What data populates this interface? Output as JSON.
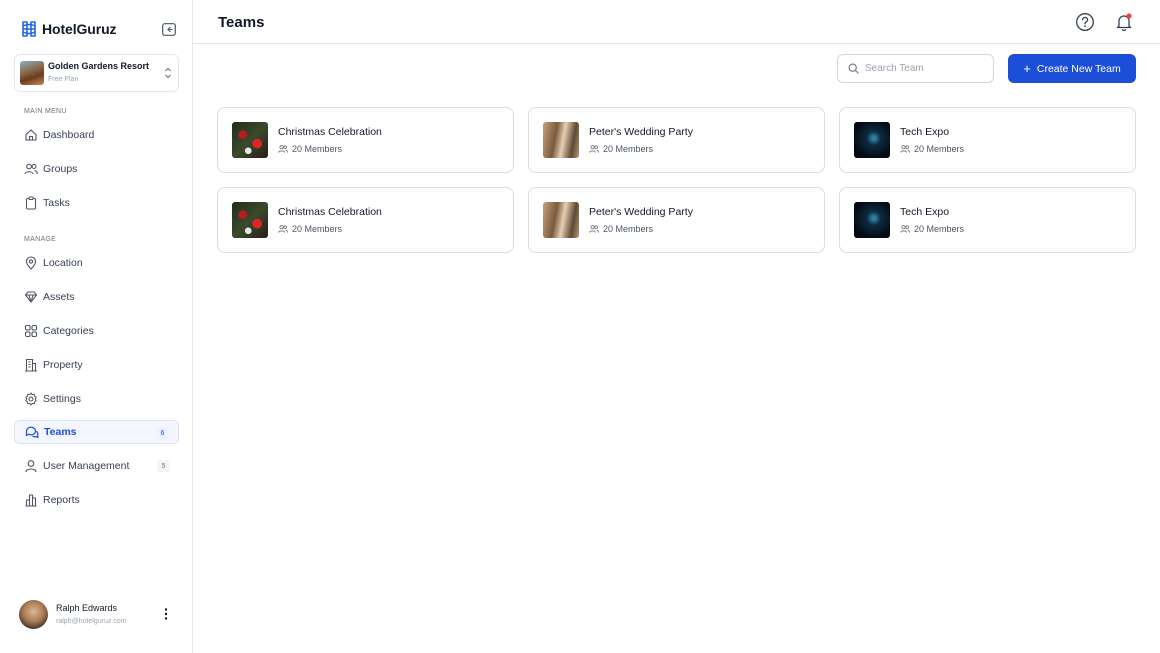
{
  "app": {
    "name": "HotelGuruz"
  },
  "hotel": {
    "name": "Golden Gardens Resort",
    "plan": "Free Plan"
  },
  "sidebar": {
    "main_menu_label": "MAIN MENU",
    "manage_label": "MANAGE",
    "main_items": [
      {
        "label": "Dashboard",
        "icon": "home-icon"
      },
      {
        "label": "Groups",
        "icon": "users-icon"
      },
      {
        "label": "Tasks",
        "icon": "clipboard-icon"
      }
    ],
    "manage_items": [
      {
        "label": "Location",
        "icon": "map-pin-icon"
      },
      {
        "label": "Assets",
        "icon": "diamond-icon"
      },
      {
        "label": "Categories",
        "icon": "grid-icon"
      },
      {
        "label": "Property",
        "icon": "building-icon"
      },
      {
        "label": "Settings",
        "icon": "gear-icon"
      },
      {
        "label": "Teams",
        "icon": "chat-bubbles-icon",
        "badge": "6",
        "active": true
      },
      {
        "label": "User Management",
        "icon": "user-icon",
        "badge": "5"
      },
      {
        "label": "Reports",
        "icon": "bar-chart-icon"
      }
    ]
  },
  "user": {
    "name": "Ralph Edwards",
    "email": "ralph@hotelguruz.com"
  },
  "header": {
    "title": "Teams"
  },
  "search": {
    "placeholder": "Search Team"
  },
  "actions": {
    "create_label": "Create New Team"
  },
  "colors": {
    "accent": "#1d4ed8",
    "notification_dot": "#ef4444"
  },
  "teams": [
    {
      "name": "Christmas Celebration",
      "members": "20 Members",
      "image": "christmas-ornaments"
    },
    {
      "name": "Peter's Wedding Party",
      "members": "20 Members",
      "image": "wedding-flowers"
    },
    {
      "name": "Tech Expo",
      "members": "20 Members",
      "image": "tech-lights"
    },
    {
      "name": "Christmas Celebration",
      "members": "20 Members",
      "image": "christmas-ornaments"
    },
    {
      "name": "Peter's Wedding Party",
      "members": "20 Members",
      "image": "wedding-flowers"
    },
    {
      "name": "Tech Expo",
      "members": "20 Members",
      "image": "tech-lights"
    }
  ]
}
